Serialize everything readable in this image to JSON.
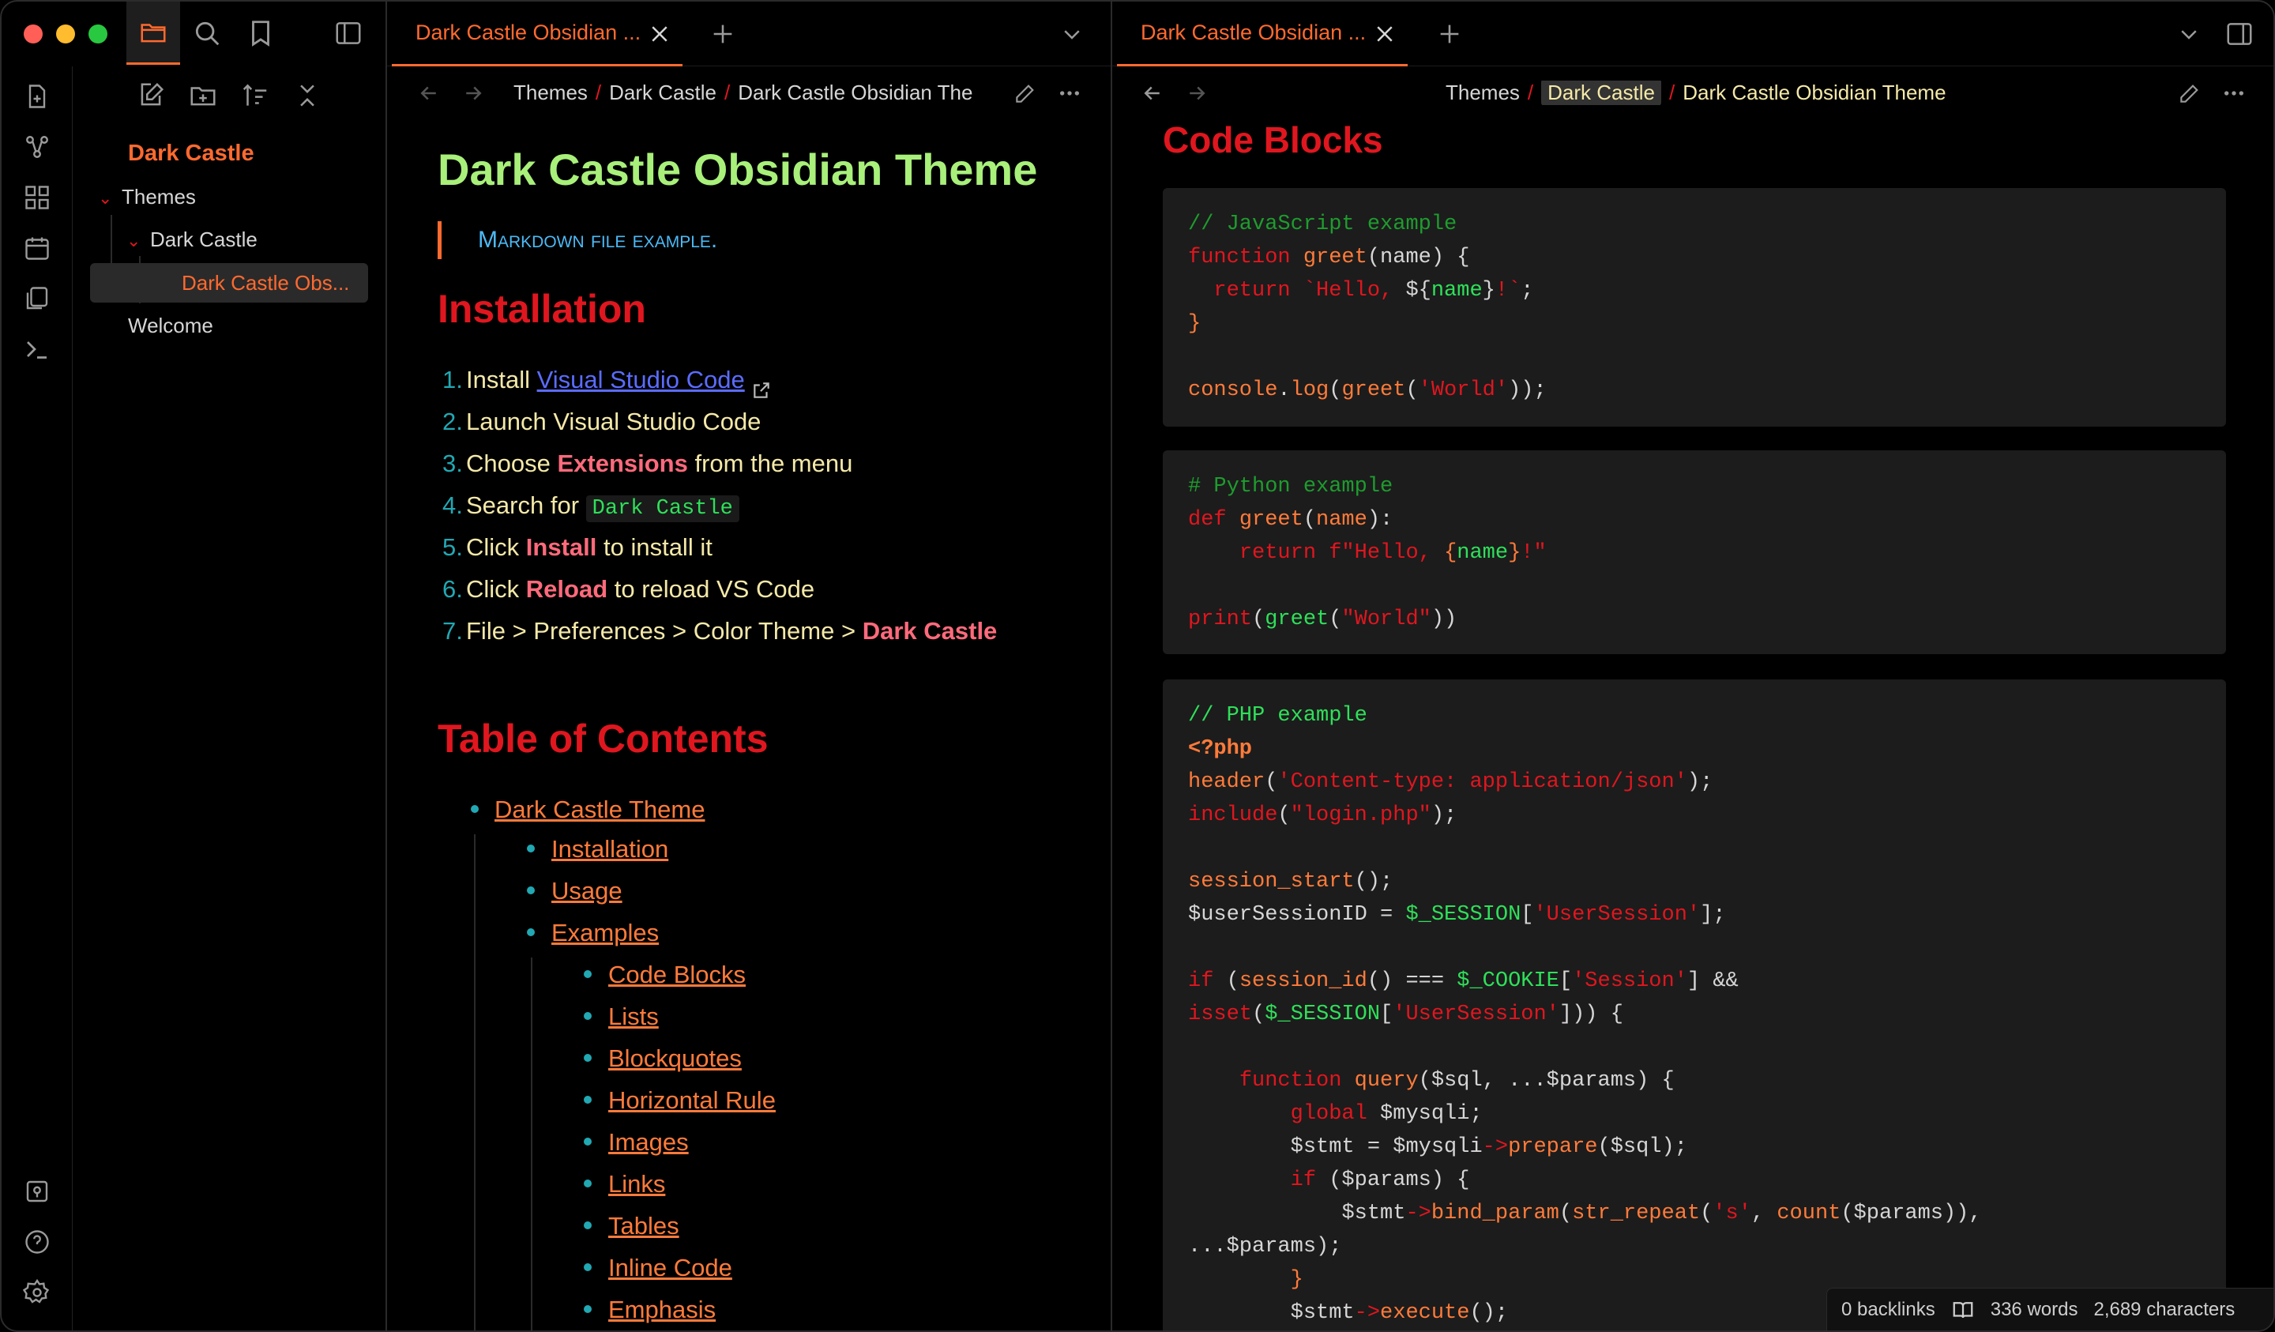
{
  "app": {
    "accent": "#ff6a2f",
    "red": "#e0161f"
  },
  "sidebar": {
    "vault_name": "Dark Castle",
    "tree": [
      {
        "label": "Themes"
      },
      {
        "label": "Dark Castle"
      },
      {
        "label": "Dark Castle Obs..."
      },
      {
        "label": "Welcome"
      }
    ]
  },
  "left_pane": {
    "tab_title": "Dark Castle Obsidian ...",
    "breadcrumb": [
      "Themes",
      "Dark Castle",
      "Dark Castle Obsidian The"
    ],
    "title": "Dark Castle Obsidian Theme",
    "quote": "Markdown file example.",
    "installation_heading": "Installation",
    "steps": [
      {
        "num": "1.",
        "pre": "Install ",
        "link": "Visual Studio Code"
      },
      {
        "num": "2.",
        "pre": "Launch Visual Studio Code"
      },
      {
        "num": "3.",
        "pre": "Choose ",
        "kw": "Extensions",
        "post": " from the menu"
      },
      {
        "num": "4.",
        "pre": "Search for ",
        "code": "Dark Castle"
      },
      {
        "num": "5.",
        "pre": "Click ",
        "kw": "Install",
        "post": " to install it"
      },
      {
        "num": "6.",
        "pre": "Click ",
        "kw": "Reload",
        "post": " to reload VS Code"
      },
      {
        "num": "7.",
        "pre": "File > Preferences > Color Theme > ",
        "kw": "Dark Castle"
      }
    ],
    "toc_heading": "Table of Contents",
    "toc": [
      "Dark Castle Theme",
      "Installation",
      "Usage",
      "Examples",
      "Code Blocks",
      "Lists",
      "Blockquotes",
      "Horizontal Rule",
      "Images",
      "Links",
      "Tables",
      "Inline Code",
      "Emphasis"
    ]
  },
  "right_pane": {
    "tab_title": "Dark Castle Obsidian ...",
    "breadcrumb": [
      "Themes",
      "Dark Castle",
      "Dark Castle Obsidian Theme"
    ],
    "heading": "Code Blocks",
    "code": {
      "js_comment": "// JavaScript example",
      "py_comment": "# Python example",
      "php_comment": "// PHP example"
    },
    "status": {
      "backlinks": "0 backlinks",
      "words": "336 words",
      "chars": "2,689 characters"
    }
  }
}
